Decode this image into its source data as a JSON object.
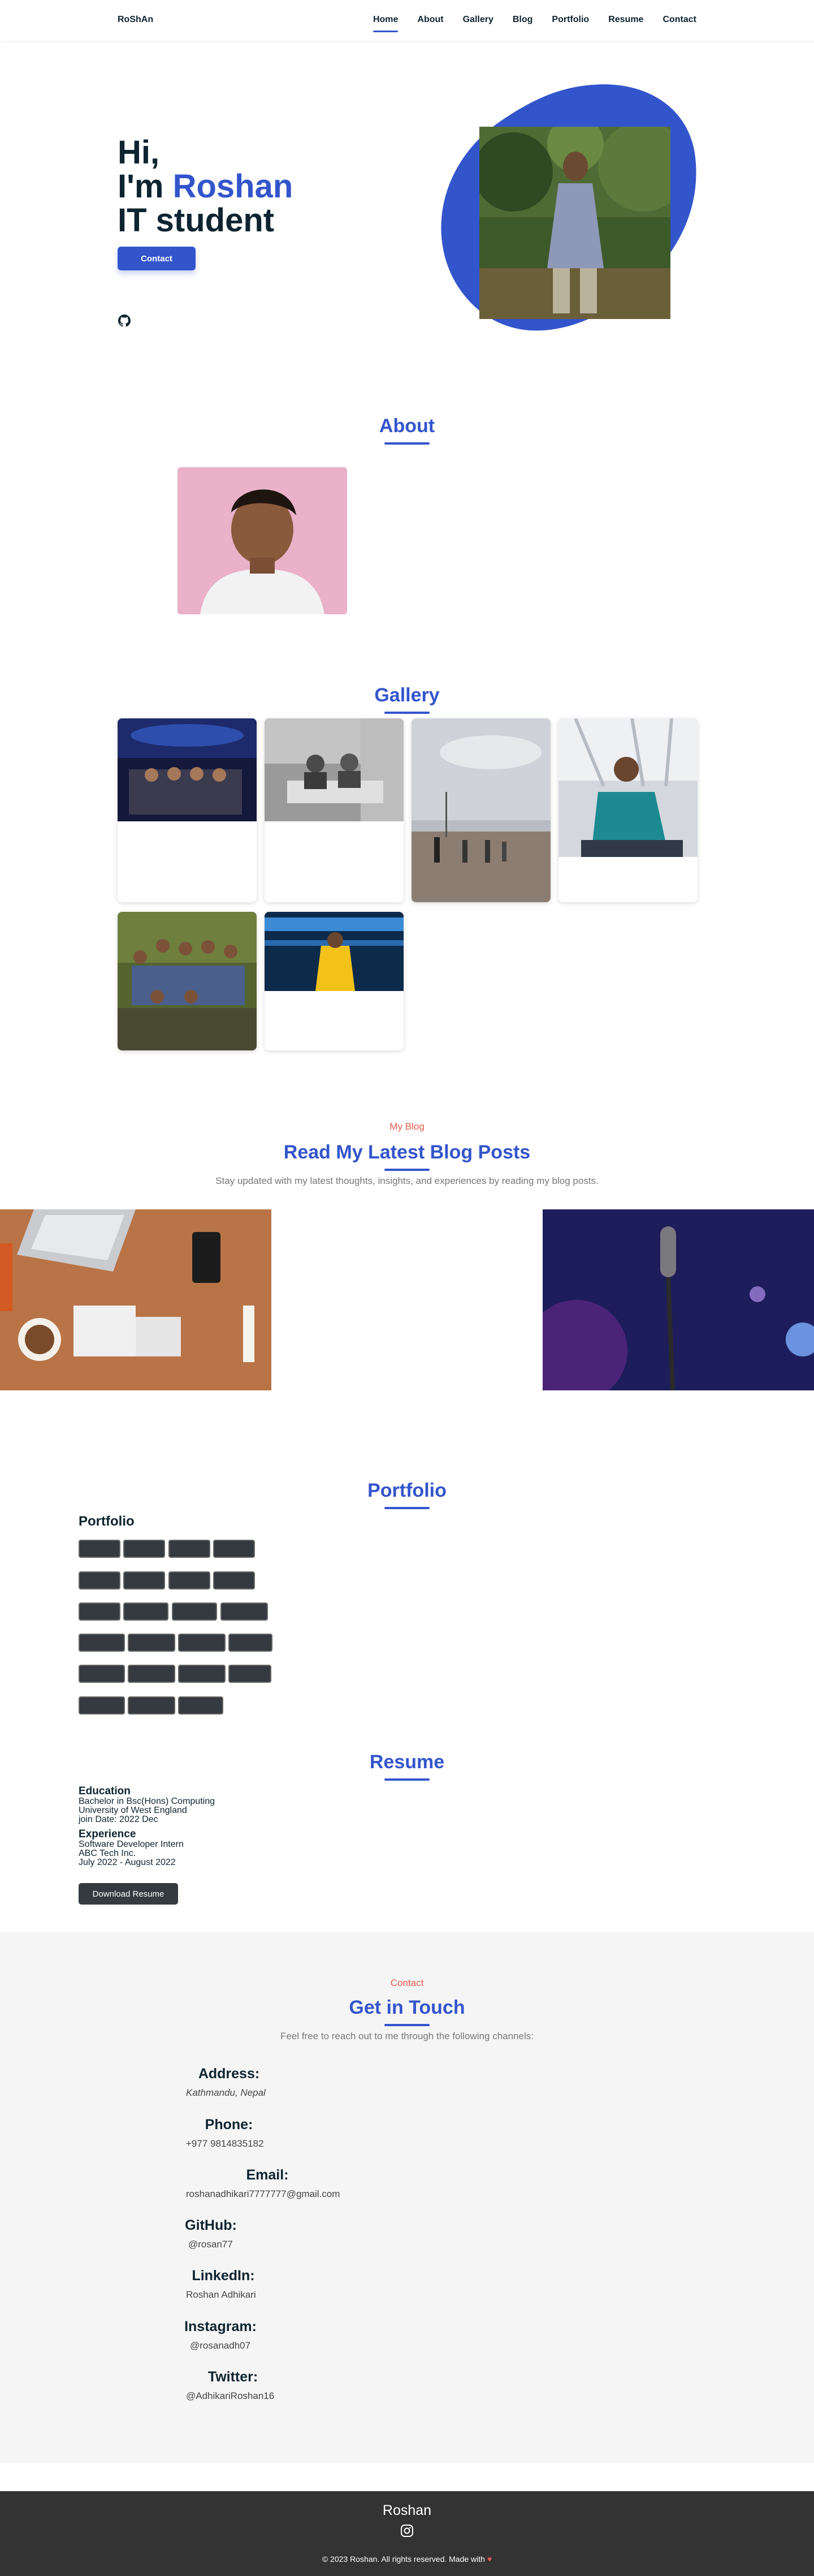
{
  "header": {
    "logo": "RoShAn",
    "nav": [
      "Home",
      "About",
      "Gallery",
      "Blog",
      "Portfolio",
      "Resume",
      "Contact"
    ],
    "active": "Home"
  },
  "hero": {
    "line1": "Hi,",
    "line2_prefix": "I'm ",
    "line2_name": "Roshan",
    "line3": "IT student",
    "contact_button": "Contact",
    "social_icon": "github-icon"
  },
  "about": {
    "title": "About"
  },
  "gallery": {
    "title": "Gallery"
  },
  "blog": {
    "kicker": "My Blog",
    "title": "Read My Latest Blog Posts",
    "subtitle": "Stay updated with my latest thoughts, insights, and experiences by reading my blog posts."
  },
  "portfolio": {
    "title": "Portfolio",
    "label": "Portfolio"
  },
  "resume": {
    "title": "Resume",
    "education_heading": "Education",
    "education_degree": "Bachelor in Bsc(Hons) Computing",
    "education_university": "University of West England",
    "education_join": "join Date: 2022 Dec",
    "experience_heading": "Experience",
    "experience_role": "Software Developer Intern",
    "experience_company": "ABC Tech Inc.",
    "experience_period": "July 2022 - August 2022",
    "download_button": "Download Resume"
  },
  "contact": {
    "kicker": "Contact",
    "title": "Get in Touch",
    "subtitle": "Feel free to reach out to me through the following channels:",
    "items": [
      {
        "label": "Address:",
        "value": "Kathmandu, Nepal"
      },
      {
        "label": "Phone:",
        "value": "+977 9814835182"
      },
      {
        "label": "Email:",
        "value": "roshanadhikari7777777@gmail.com"
      },
      {
        "label": "GitHub:",
        "value": "@rosan77"
      },
      {
        "label": "LinkedIn:",
        "value": "Roshan Adhikari"
      },
      {
        "label": "Instagram:",
        "value": "@rosanadh07"
      },
      {
        "label": "Twitter:",
        "value": "@AdhikariRoshan16"
      }
    ]
  },
  "footer": {
    "name": "Roshan",
    "social_icon": "instagram-icon",
    "copyright": "© 2023 Roshan. All rights reserved. Made with",
    "heart": "♥"
  },
  "colors": {
    "accent": "#3355cc",
    "text": "#0e2431",
    "kicker": "#e35b4b",
    "footer_bg": "#333333",
    "contact_bg": "#f5f5f5"
  }
}
